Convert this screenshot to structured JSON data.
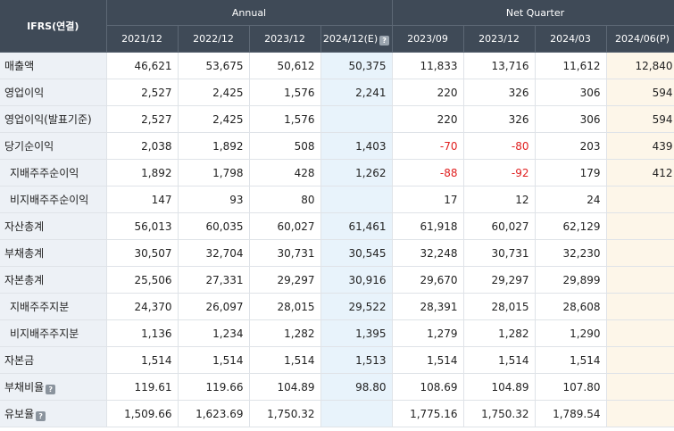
{
  "header": {
    "corner_label": "IFRS(연결)",
    "group_annual": "Annual",
    "group_quarter": "Net Quarter",
    "periods": [
      "2021/12",
      "2022/12",
      "2023/12",
      "2024/12(E)",
      "2023/09",
      "2023/12",
      "2024/03",
      "2024/06(P)"
    ]
  },
  "rows": [
    {
      "label": "매출액",
      "values": [
        "46,621",
        "53,675",
        "50,612",
        "50,375",
        "11,833",
        "13,716",
        "11,612",
        "12,840"
      ]
    },
    {
      "label": "영업이익",
      "values": [
        "2,527",
        "2,425",
        "1,576",
        "2,241",
        "220",
        "326",
        "306",
        "594"
      ]
    },
    {
      "label": "영업이익(발표기준)",
      "values": [
        "2,527",
        "2,425",
        "1,576",
        "",
        "220",
        "326",
        "306",
        "594"
      ]
    },
    {
      "label": "당기순이익",
      "values": [
        "2,038",
        "1,892",
        "508",
        "1,403",
        "-70",
        "-80",
        "203",
        "439"
      ]
    },
    {
      "label": "지배주주순이익",
      "values": [
        "1,892",
        "1,798",
        "428",
        "1,262",
        "-88",
        "-92",
        "179",
        "412"
      ]
    },
    {
      "label": "비지배주주순이익",
      "values": [
        "147",
        "93",
        "80",
        "",
        "17",
        "12",
        "24",
        ""
      ]
    },
    {
      "label": "자산총계",
      "values": [
        "56,013",
        "60,035",
        "60,027",
        "61,461",
        "61,918",
        "60,027",
        "62,129",
        ""
      ]
    },
    {
      "label": "부채총계",
      "values": [
        "30,507",
        "32,704",
        "30,731",
        "30,545",
        "32,248",
        "30,731",
        "32,230",
        ""
      ]
    },
    {
      "label": "자본총계",
      "values": [
        "25,506",
        "27,331",
        "29,297",
        "30,916",
        "29,670",
        "29,297",
        "29,899",
        ""
      ]
    },
    {
      "label": "지배주주지분",
      "values": [
        "24,370",
        "26,097",
        "28,015",
        "29,522",
        "28,391",
        "28,015",
        "28,608",
        ""
      ]
    },
    {
      "label": "비지배주주지분",
      "values": [
        "1,136",
        "1,234",
        "1,282",
        "1,395",
        "1,279",
        "1,282",
        "1,290",
        ""
      ]
    },
    {
      "label": "자본금",
      "values": [
        "1,514",
        "1,514",
        "1,514",
        "1,513",
        "1,514",
        "1,514",
        "1,514",
        ""
      ]
    },
    {
      "label": "부채비율",
      "values": [
        "119.61",
        "119.66",
        "104.89",
        "98.80",
        "108.69",
        "104.89",
        "107.80",
        ""
      ]
    },
    {
      "label": "유보율",
      "values": [
        "1,509.66",
        "1,623.69",
        "1,750.32",
        "",
        "1,775.16",
        "1,750.32",
        "1,789.54",
        ""
      ]
    }
  ],
  "icons": {
    "help": "?"
  }
}
